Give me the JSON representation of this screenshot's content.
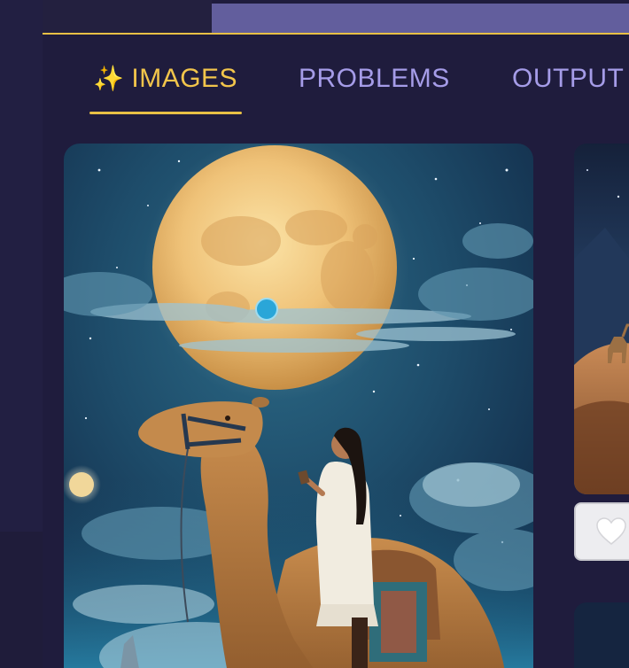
{
  "tabs": [
    {
      "label": "IMAGES",
      "icon": "sparkles-icon",
      "active": true
    },
    {
      "label": "PROBLEMS",
      "active": false
    },
    {
      "label": "OUTPUT",
      "active": false
    }
  ],
  "colors": {
    "accent": "#e8c045",
    "tab_inactive": "#a59ce8",
    "background": "#1f1c3d",
    "header_bar": "#625e9d"
  },
  "gallery": {
    "main_image": {
      "icon": "camel-moon-painting"
    },
    "side_image": {
      "icon": "desert-camel-painting"
    },
    "like_button": {
      "icon": "heart-icon"
    }
  }
}
